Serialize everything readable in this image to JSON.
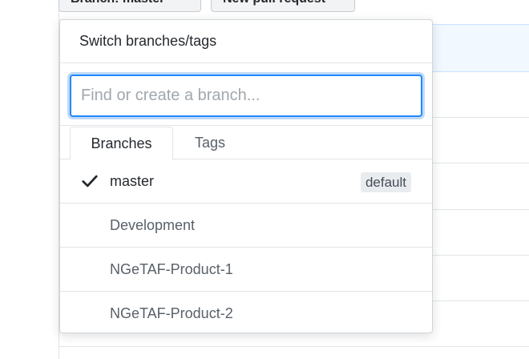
{
  "background": {
    "branch_button_label": "Branch: master",
    "pull_request_button_label": "New pull request"
  },
  "dropdown": {
    "header_title": "Switch branches/tags",
    "filter_placeholder": "Find or create a branch...",
    "tabs": [
      {
        "label": "Branches",
        "active": true
      },
      {
        "label": "Tags",
        "active": false
      }
    ],
    "branches": [
      {
        "name": "master",
        "selected": true,
        "badge": "default"
      },
      {
        "name": "Development",
        "selected": false
      },
      {
        "name": "NGeTAF-Product-1",
        "selected": false
      },
      {
        "name": "NGeTAF-Product-2",
        "selected": false
      }
    ]
  },
  "icons": {
    "selected_marker": "check-icon"
  },
  "colors": {
    "accent": "#2188ff",
    "text": "#24292e",
    "muted_text": "#586069",
    "border": "#e1e4e8"
  }
}
